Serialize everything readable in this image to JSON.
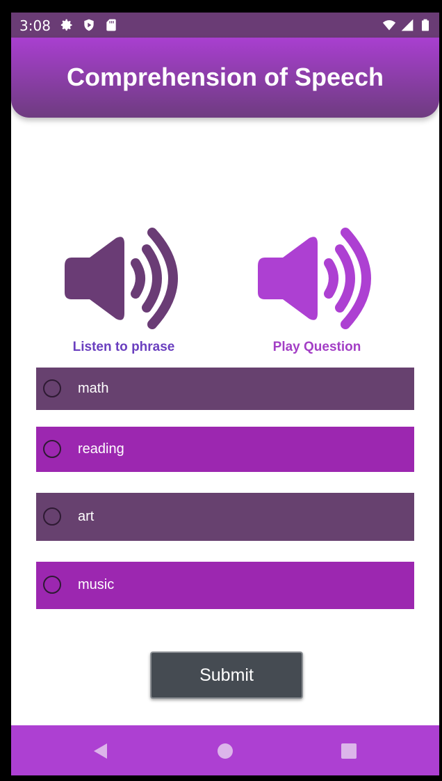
{
  "status_bar": {
    "time": "3:08",
    "left_icons": [
      "gear-icon",
      "shield-play-icon",
      "sd-card-icon"
    ],
    "right_icons": [
      "wifi-icon",
      "signal-icon",
      "battery-icon"
    ]
  },
  "header": {
    "title": "Comprehension of Speech"
  },
  "audio_buttons": [
    {
      "label": "Listen to phrase",
      "icon": "speaker-icon",
      "color": "#6a3c75"
    },
    {
      "label": "Play Question",
      "icon": "speaker-icon",
      "color": "#ad40d2"
    }
  ],
  "options": [
    {
      "label": "math",
      "color": "#67416f"
    },
    {
      "label": "reading",
      "color": "#9c27b0"
    },
    {
      "label": "art",
      "color": "#67416f"
    },
    {
      "label": "music",
      "color": "#9c27b0"
    }
  ],
  "submit": {
    "label": "Submit"
  },
  "nav_bar": {
    "buttons": [
      "back-icon",
      "home-icon",
      "recents-icon"
    ],
    "color": "#ad40d2"
  }
}
